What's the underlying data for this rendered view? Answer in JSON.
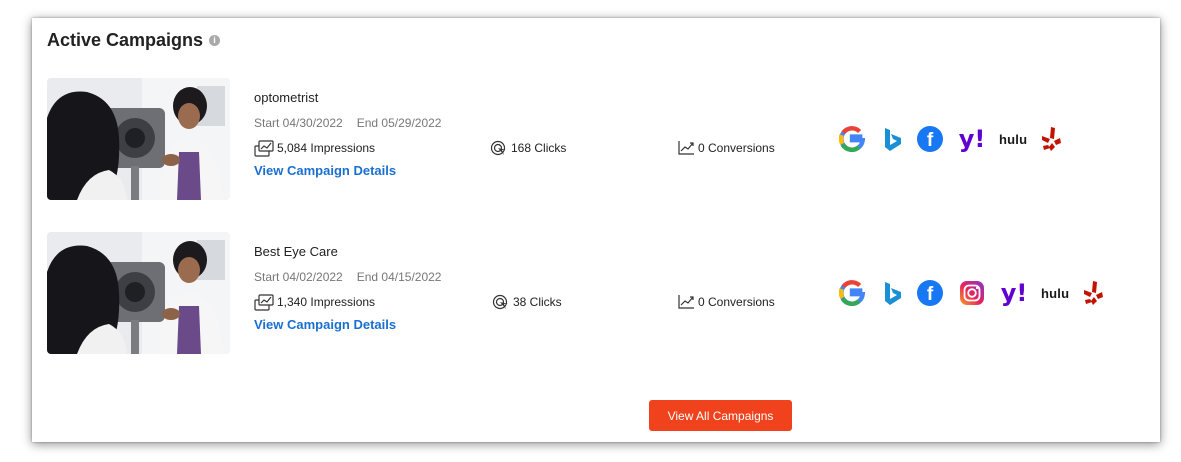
{
  "panel": {
    "title": "Active Campaigns",
    "info_glyph": "i",
    "cta_label": "View All Campaigns",
    "cta_color": "#f0421c",
    "link_color": "#1a6fd0"
  },
  "campaigns": [
    {
      "name": "optometrist",
      "start": "Start 04/30/2022",
      "end": "End 05/29/2022",
      "impressions": "5,084 Impressions",
      "clicks": "168 Clicks",
      "conversions": "0 Conversions",
      "details_label": "View Campaign Details",
      "channels": [
        "google-icon",
        "bing-icon",
        "facebook-icon",
        "yahoo-icon",
        "hulu-icon",
        "yelp-icon"
      ]
    },
    {
      "name": "Best Eye Care",
      "start": "Start 04/02/2022",
      "end": "End 04/15/2022",
      "impressions": "1,340 Impressions",
      "clicks": "38 Clicks",
      "conversions": "0 Conversions",
      "details_label": "View Campaign Details",
      "channels": [
        "google-icon",
        "bing-icon",
        "facebook-icon",
        "instagram-icon",
        "yahoo-icon",
        "hulu-icon",
        "yelp-icon"
      ]
    }
  ],
  "logos": {
    "yahoo_text": "y!",
    "hulu_text": "hulu",
    "facebook_text": "f"
  }
}
